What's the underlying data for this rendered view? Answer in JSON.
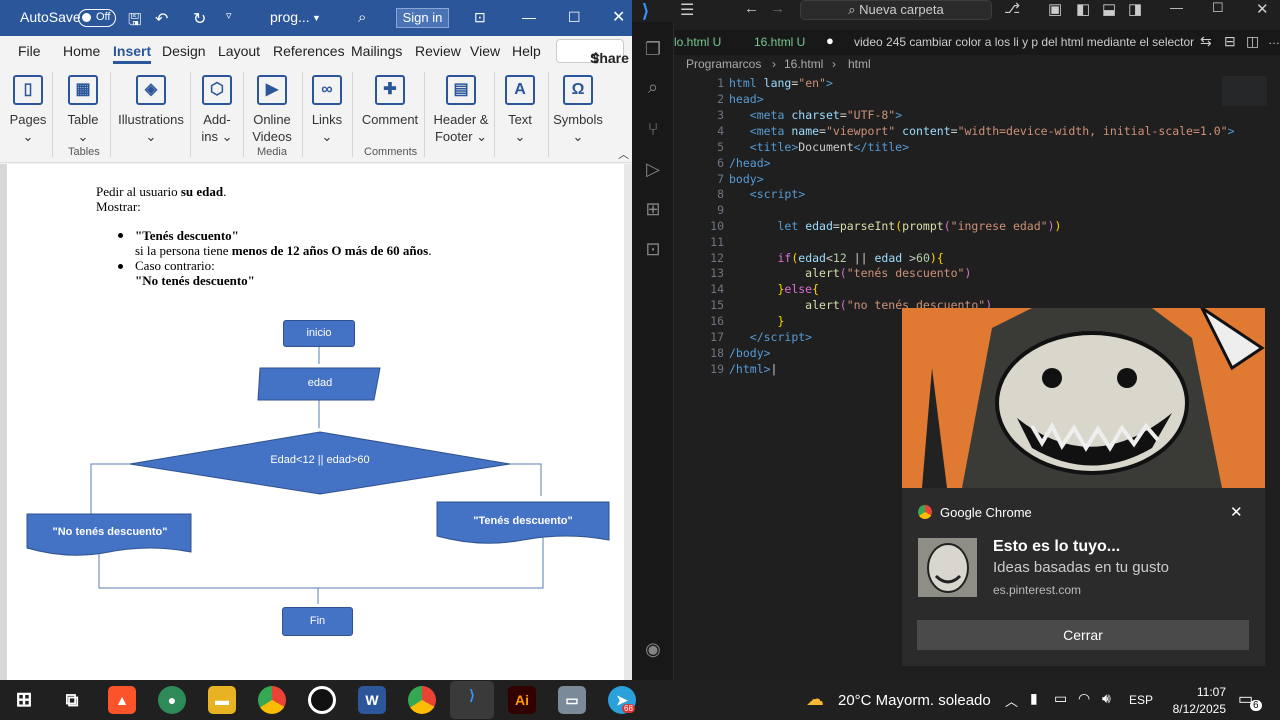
{
  "word": {
    "autosave_label": "AutoSave",
    "autosave_state": "Off",
    "doc_name": "prog...",
    "signin": "Sign in",
    "menu": [
      "File",
      "Home",
      "Insert",
      "Design",
      "Layout",
      "References",
      "Mailings",
      "Review",
      "View",
      "Help"
    ],
    "share": "Share",
    "ribbon": {
      "pages": "Pages",
      "table": "Table",
      "illustrations": "Illustrations",
      "addins": "Add-\nins",
      "online_videos": "Online\nVideos",
      "links": "Links",
      "comment": "Comment",
      "header_footer": "Header &\nFooter",
      "text": "Text",
      "symbols": "Symbols",
      "groups": {
        "tables": "Tables",
        "media": "Media",
        "comments": "Comments"
      }
    },
    "doc": {
      "l1a": "Pedir al usuario ",
      "l1b": "su edad",
      "l1c": ".",
      "l2": "Mostrar:",
      "b1": "\"Tenés descuento\"",
      "b1sa": "si la persona tiene ",
      "b1sb": "menos de 12 años O más de 60 años",
      "b1sc": ".",
      "b2": "Caso contrario:",
      "b2s": "\"No tenés descuento\""
    },
    "flow": {
      "inicio": "inicio",
      "edad": "edad",
      "cond": "Edad<12 || edad>60",
      "no": "\"No tenés descuento\"",
      "yes": "\"Tenés descuento\"",
      "fin": "Fin"
    }
  },
  "vscode": {
    "search": "Nueva carpeta",
    "tabs": [
      "lo.html U",
      "16.html U",
      "video 245 cambiar color a los li y p del html mediante el selector un"
    ],
    "breadcrumb": [
      "Programarcos",
      "16.html",
      "html"
    ],
    "line_numbers": [
      "1",
      "2",
      "3",
      "4",
      "5",
      "6",
      "7",
      "8",
      "9",
      "10",
      "11",
      "12",
      "13",
      "14",
      "15",
      "16",
      "17",
      "18",
      "19"
    ]
  },
  "notification": {
    "app": "Google Chrome",
    "title": "Esto es lo tuyo...",
    "body": "Ideas basadas en tu gusto",
    "site": "es.pinterest.com",
    "button": "Cerrar"
  },
  "taskbar": {
    "weather": "20°C  Mayorm. soleado",
    "lang": "ESP",
    "time": "11:07",
    "date": "8/12/2025",
    "notif_count": "6",
    "telegram_badge": "68"
  }
}
